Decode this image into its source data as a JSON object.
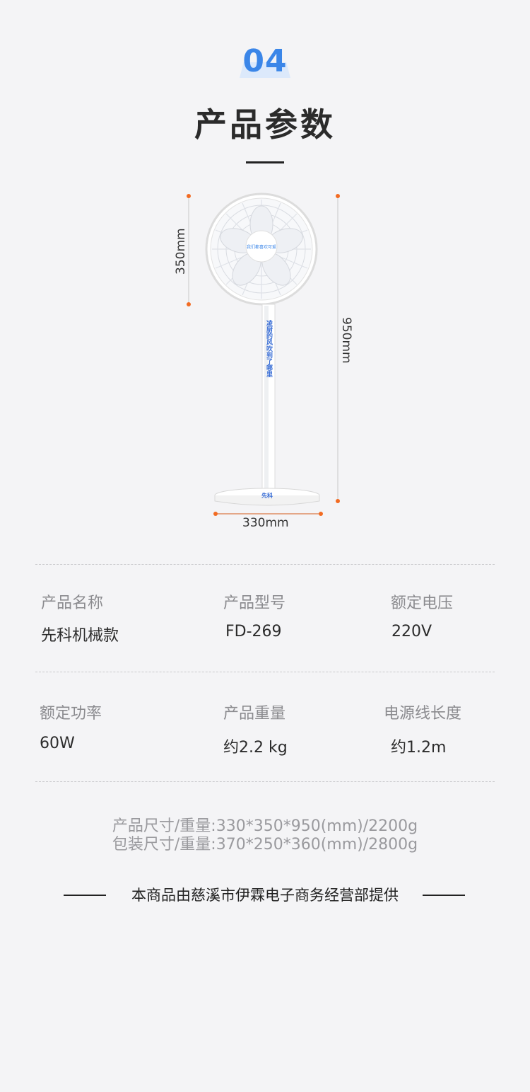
{
  "section": {
    "number": "04",
    "title": "产品参数"
  },
  "dimensions": {
    "head_height": "350mm",
    "total_height": "950mm",
    "base_width": "330mm"
  },
  "product_image": {
    "badge_text": "我们都喜欢可爱",
    "pole_text": "凌厨的风吹到了哪里",
    "base_text": "先科"
  },
  "specs": {
    "row1": [
      {
        "label": "产品名称",
        "value": "先科机械款"
      },
      {
        "label": "产品型号",
        "value": "FD-269"
      },
      {
        "label": "额定电压",
        "value": "220V"
      }
    ],
    "row2": [
      {
        "label": "额定功率",
        "value": "60W"
      },
      {
        "label": "产品重量",
        "value": "约2.2 kg"
      },
      {
        "label": "电源线长度",
        "value": "约1.2m"
      }
    ]
  },
  "footer": {
    "product_size": "产品尺寸/重量:330*350*950(mm)/2200g",
    "package_size": "包装尺寸/重量:370*250*360(mm)/2800g",
    "provider": "本商品由慈溪市伊霖电子商务经营部提供"
  },
  "colors": {
    "accent": "#3b86e8",
    "dim_dot": "#f26b22",
    "text": "#2b2b2b",
    "muted": "#8b8b8f"
  }
}
